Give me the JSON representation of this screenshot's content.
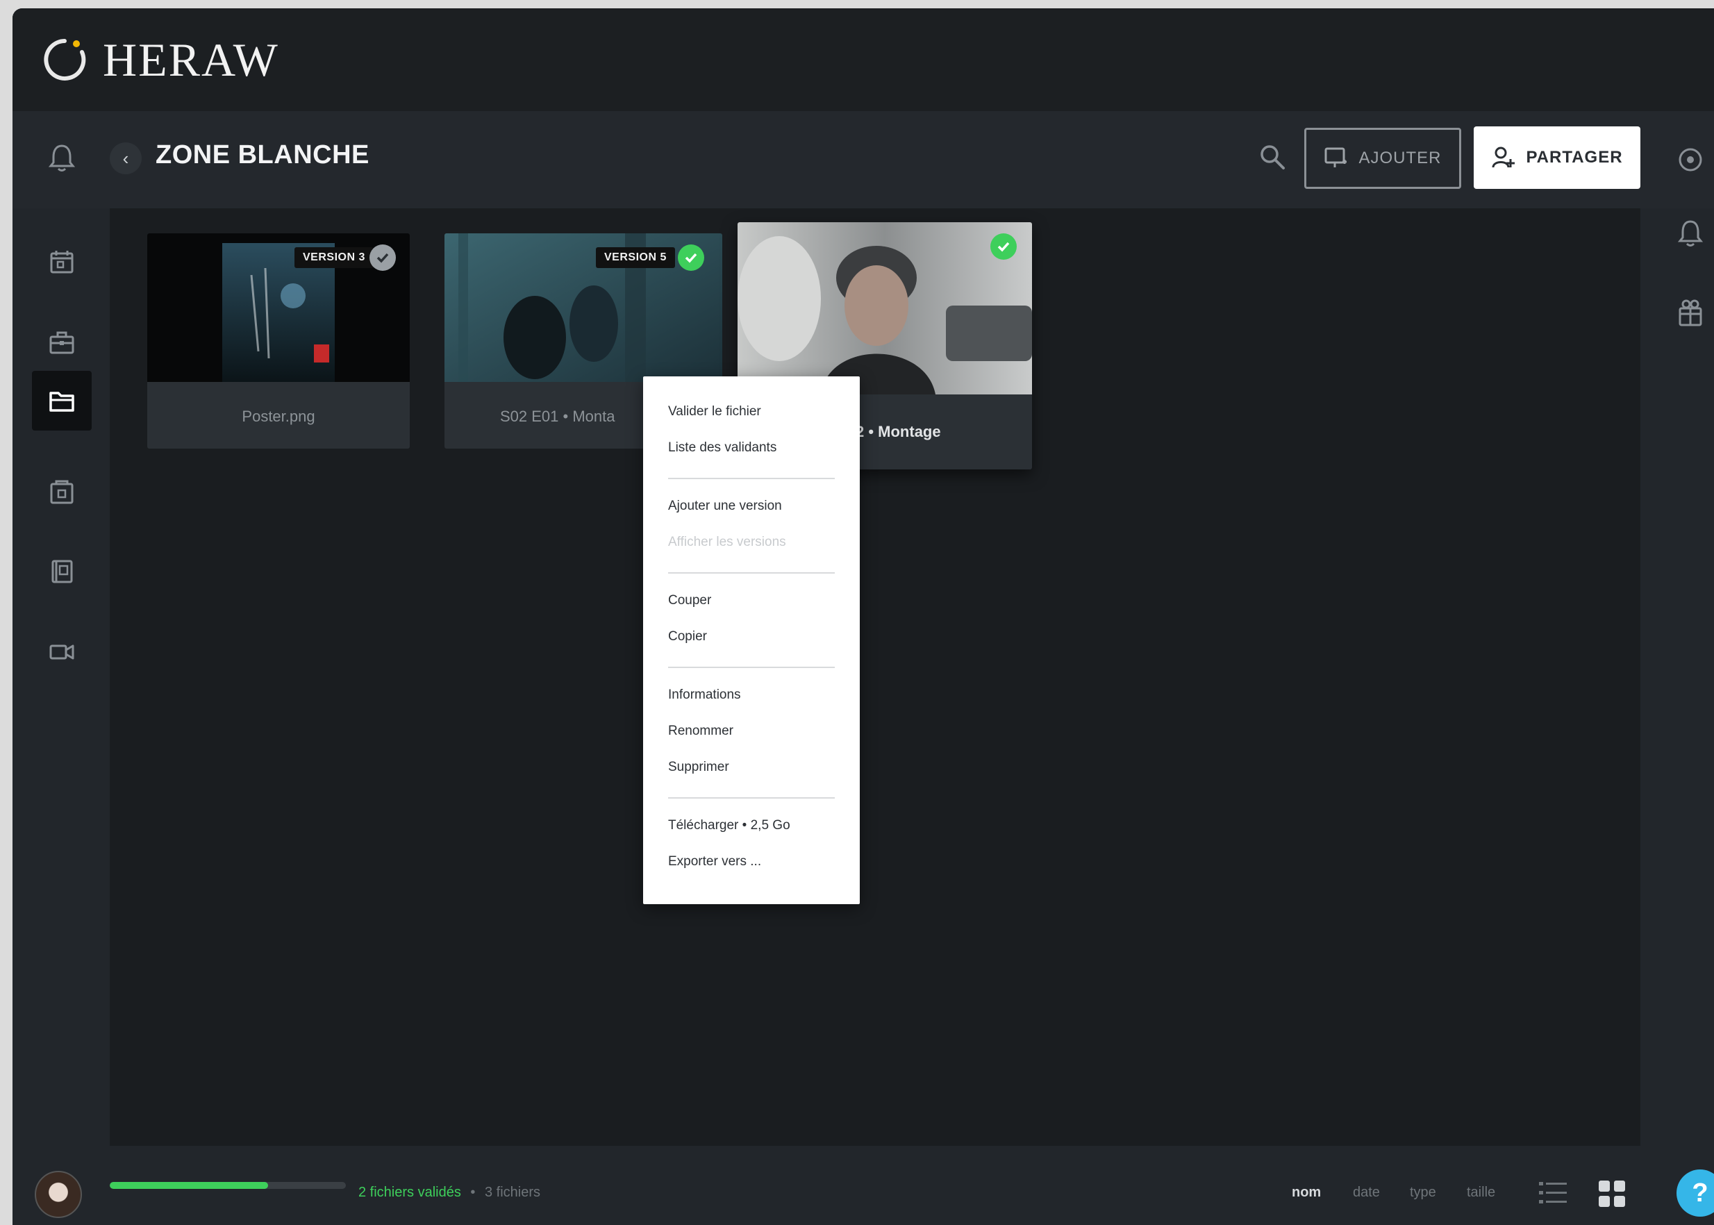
{
  "brand": {
    "name": "HERAW",
    "accent": "#f2b705"
  },
  "header": {
    "back_icon": "chevron-left-icon",
    "project_title": "ZONE BLANCHE",
    "add_label": "AJOUTER",
    "share_label": "PARTAGER"
  },
  "sidebar": {
    "items": [
      {
        "icon": "bell-icon"
      },
      {
        "icon": "calendar-icon"
      },
      {
        "icon": "briefcase-icon"
      },
      {
        "icon": "folder-icon",
        "active": true
      },
      {
        "icon": "archive-box-icon"
      },
      {
        "icon": "book-icon"
      },
      {
        "icon": "video-camera-icon"
      }
    ]
  },
  "files": [
    {
      "caption": "Poster.png",
      "badge": "VERSION 3",
      "validated": false
    },
    {
      "caption": "S02 E01 • Monta",
      "badge": "VERSION 5",
      "validated": true
    },
    {
      "caption": "2 • Montage",
      "badge": "",
      "validated": true
    }
  ],
  "context_menu": {
    "items": [
      "Valider le fichier",
      "Liste des validants",
      "Ajouter une version",
      "Afficher les versions",
      "Couper",
      "Copier",
      "Informations",
      "Renommer",
      "Supprimer",
      "Télécharger • 2,5 Go",
      "Exporter vers ..."
    ]
  },
  "footer": {
    "progress": 0.67,
    "validated_text": "2 fichiers validés",
    "separator": "•",
    "total_text": "3 fichiers",
    "sort_options": [
      "nom",
      "date",
      "type",
      "taille"
    ],
    "active_sort": "nom",
    "help_label": "?"
  },
  "colors": {
    "validated_green": "#3ecf5b",
    "help_blue": "#35b6e8"
  }
}
